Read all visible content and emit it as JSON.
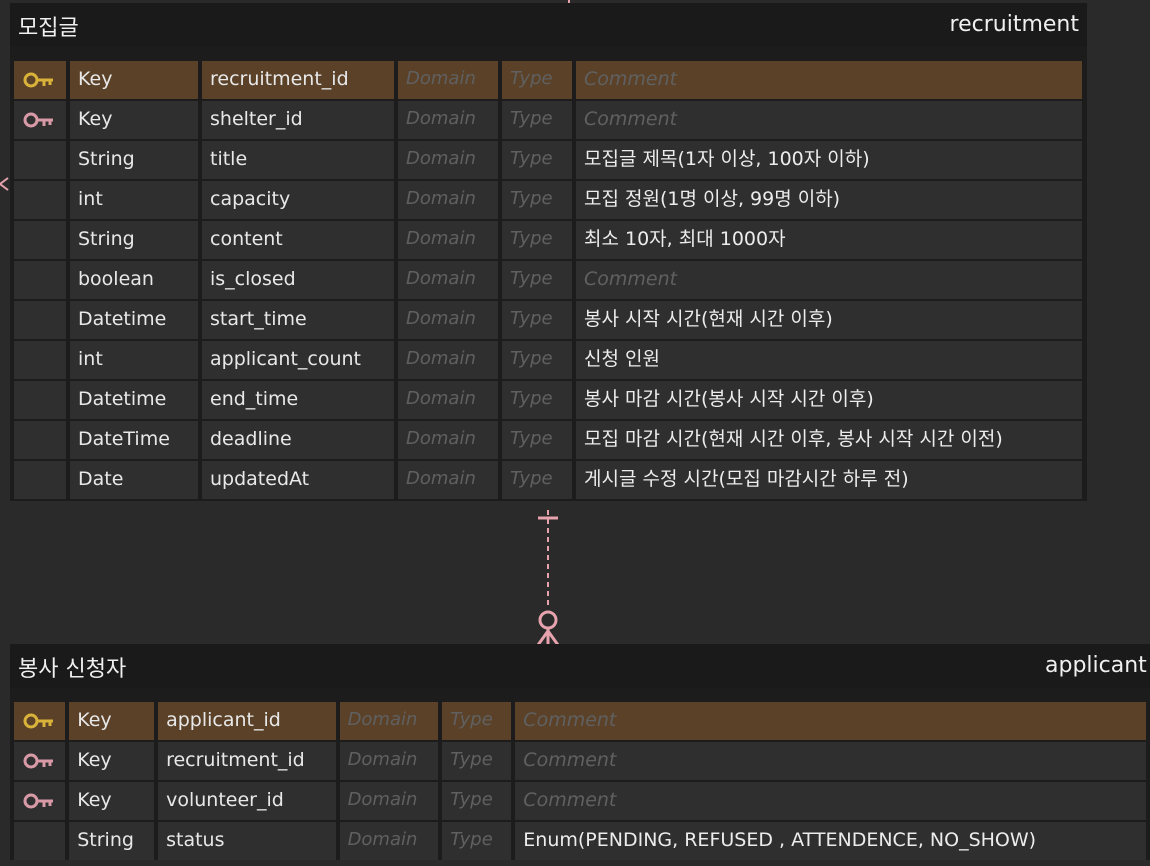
{
  "colors": {
    "pk_key_icon": "#d9b23a",
    "fk_key_icon": "#d89aa6",
    "pk_row_bg": "#5a4128",
    "relation_line": "#e6a3ae"
  },
  "tables": [
    {
      "logical_name": "모집글",
      "physical_name": "recruitment",
      "columns": [
        {
          "icon": "pk-key-icon",
          "type": "Key",
          "name": "recruitment_id",
          "domain": "Domain",
          "datatype": "Type",
          "comment": "Comment",
          "comment_is_placeholder": true,
          "pk": true
        },
        {
          "icon": "fk-key-icon",
          "type": "Key",
          "name": "shelter_id",
          "domain": "Domain",
          "datatype": "Type",
          "comment": "Comment",
          "comment_is_placeholder": true,
          "pk": false
        },
        {
          "icon": "",
          "type": "String",
          "name": "title",
          "domain": "Domain",
          "datatype": "Type",
          "comment": "모집글 제목(1자 이상, 100자 이하)",
          "comment_is_placeholder": false,
          "pk": false
        },
        {
          "icon": "",
          "type": "int",
          "name": "capacity",
          "domain": "Domain",
          "datatype": "Type",
          "comment": "모집 정원(1명 이상, 99명 이하)",
          "comment_is_placeholder": false,
          "pk": false
        },
        {
          "icon": "",
          "type": "String",
          "name": "content",
          "domain": "Domain",
          "datatype": "Type",
          "comment": "최소 10자, 최대 1000자",
          "comment_is_placeholder": false,
          "pk": false
        },
        {
          "icon": "",
          "type": "boolean",
          "name": "is_closed",
          "domain": "Domain",
          "datatype": "Type",
          "comment": "Comment",
          "comment_is_placeholder": true,
          "pk": false
        },
        {
          "icon": "",
          "type": "Datetime",
          "name": "start_time",
          "domain": "Domain",
          "datatype": "Type",
          "comment": "봉사 시작 시간(현재 시간 이후)",
          "comment_is_placeholder": false,
          "pk": false
        },
        {
          "icon": "",
          "type": "int",
          "name": "applicant_count",
          "domain": "Domain",
          "datatype": "Type",
          "comment": "신청 인원",
          "comment_is_placeholder": false,
          "pk": false
        },
        {
          "icon": "",
          "type": "Datetime",
          "name": "end_time",
          "domain": "Domain",
          "datatype": "Type",
          "comment": "봉사 마감 시간(봉사 시작 시간 이후)",
          "comment_is_placeholder": false,
          "pk": false
        },
        {
          "icon": "",
          "type": "DateTime",
          "name": "deadline",
          "domain": "Domain",
          "datatype": "Type",
          "comment": "모집 마감 시간(현재 시간 이후, 봉사 시작 시간 이전)",
          "comment_is_placeholder": false,
          "pk": false
        },
        {
          "icon": "",
          "type": "Date",
          "name": "updatedAt",
          "domain": "Domain",
          "datatype": "Type",
          "comment": "게시글 수정 시간(모집 마감시간 하루 전)",
          "comment_is_placeholder": false,
          "pk": false
        }
      ]
    },
    {
      "logical_name": "봉사 신청자",
      "physical_name": "applicant",
      "columns": [
        {
          "icon": "pk-key-icon",
          "type": "Key",
          "name": "applicant_id",
          "domain": "Domain",
          "datatype": "Type",
          "comment": "Comment",
          "comment_is_placeholder": true,
          "pk": true
        },
        {
          "icon": "fk-key-icon",
          "type": "Key",
          "name": "recruitment_id",
          "domain": "Domain",
          "datatype": "Type",
          "comment": "Comment",
          "comment_is_placeholder": true,
          "pk": false
        },
        {
          "icon": "fk-key-icon",
          "type": "Key",
          "name": "volunteer_id",
          "domain": "Domain",
          "datatype": "Type",
          "comment": "Comment",
          "comment_is_placeholder": true,
          "pk": false
        },
        {
          "icon": "",
          "type": "String",
          "name": "status",
          "domain": "Domain",
          "datatype": "Type",
          "comment": "Enum(PENDING, REFUSED , ATTENDENCE, NO_SHOW)",
          "comment_is_placeholder": false,
          "pk": false
        }
      ]
    }
  ]
}
